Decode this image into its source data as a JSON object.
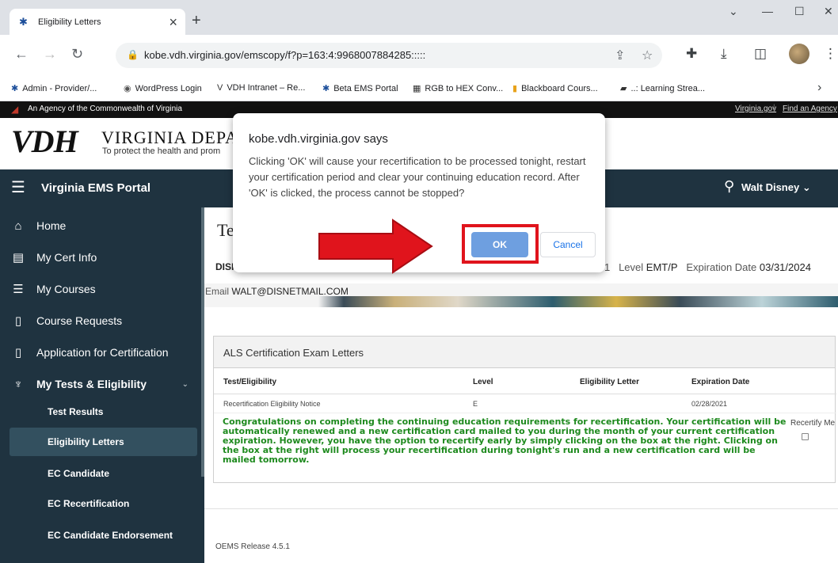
{
  "browser": {
    "tab_title": "Eligibility Letters",
    "url": "kobe.vdh.virginia.gov/emscopy/f?p=163:4:9968007884285:::::",
    "bookmarks": [
      "Admin - Provider/...",
      "WordPress Login",
      "VDH Intranet – Re...",
      "Beta EMS Portal",
      "RGB to HEX Conv...",
      "Blackboard Cours...",
      "..: Learning Strea..."
    ]
  },
  "gov_bar": {
    "text": "An Agency of the Commonwealth of Virginia",
    "links": [
      "Virginia.gov",
      "Find an Agency"
    ]
  },
  "header": {
    "logo": "VDH",
    "title": "VIRGINIA DEPA",
    "tagline": "To protect the health and prom"
  },
  "app_bar": {
    "name": "Virginia EMS Portal",
    "user": "Walt Disney"
  },
  "sidebar": {
    "items": [
      {
        "label": "Home",
        "icon": "home-icon"
      },
      {
        "label": "My Cert Info",
        "icon": "id-card-icon"
      },
      {
        "label": "My Courses",
        "icon": "list-icon"
      },
      {
        "label": "Course Requests",
        "icon": "document-icon"
      },
      {
        "label": "Application for Certification",
        "icon": "document-icon"
      },
      {
        "label": "My Tests & Eligibility",
        "icon": "award-icon"
      }
    ],
    "sub_items": [
      "Test Results",
      "Eligibility Letters",
      "EC Candidate",
      "EC Recertification",
      "EC Candidate Endorsement"
    ]
  },
  "content": {
    "title": "Te",
    "person": "DISI",
    "cert_num_fragment": "1",
    "level_label": "Level",
    "level": "EMT/P",
    "expiration_label": "Expiration Date",
    "expiration": "03/31/2024",
    "email_label": "Email",
    "email": "WALT@DISNETMAIL.COM"
  },
  "letters": {
    "region_title": "ALS Certification Exam Letters",
    "columns": [
      "Test/Eligibility",
      "Level",
      "Eligibility Letter",
      "Expiration Date"
    ],
    "row": {
      "test": "Recertification Eligibility Notice",
      "level": "E",
      "letter": "",
      "expiration": "02/28/2021"
    },
    "message": "Congratulations on completing the continuing education requirements for recertification. Your certification will be automatically renewed and a new certification card mailed to you during the month of your current certification expiration. However, you have the option to recertify early by simply clicking on the box at the right. Clicking on the box at the right will process your recertification during tonight's run and a new certification card will be mailed tomorrow.",
    "recertify_label": "Recertify Me"
  },
  "footer": {
    "release": "OEMS Release 4.5.1"
  },
  "dialog": {
    "title": "kobe.vdh.virginia.gov says",
    "message": "Clicking 'OK' will cause your recertification to be processed tonight, restart your certification period and clear your continuing education record.  After 'OK' is clicked, the process cannot be stopped?",
    "ok": "OK",
    "cancel": "Cancel"
  },
  "colors": {
    "sidebar_bg": "#1f3340",
    "highlight_red": "#e0141c",
    "ok_button": "#6e9fe0",
    "message_green": "#1e8a1e"
  }
}
